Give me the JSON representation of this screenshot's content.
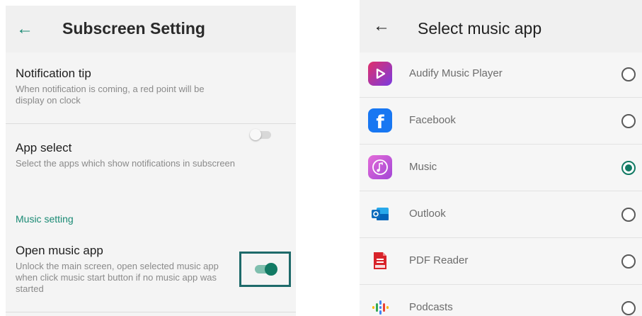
{
  "left_screen": {
    "title": "Subscreen Setting",
    "back_icon": "arrow-left-icon",
    "notification_tip": {
      "title": "Notification tip",
      "description": "When notification is coming, a red point will be display on clock",
      "enabled": false
    },
    "app_select": {
      "title": "App select",
      "description": "Select the apps which show notifications in subscreen"
    },
    "section_label": "Music setting",
    "open_music_app": {
      "title": "Open music app",
      "description": "Unlock the main screen, open selected music app when click music start button if no music app was started",
      "enabled": true
    },
    "accent_color": "#1a8a74"
  },
  "right_screen": {
    "title": "Select music app",
    "back_icon": "arrow-left-icon",
    "apps": [
      {
        "label": "Audify Music Player",
        "icon": "audify-icon",
        "selected": false
      },
      {
        "label": "Facebook",
        "icon": "facebook-icon",
        "selected": false
      },
      {
        "label": "Music",
        "icon": "music-icon",
        "selected": true
      },
      {
        "label": "Outlook",
        "icon": "outlook-icon",
        "selected": false
      },
      {
        "label": "PDF Reader",
        "icon": "pdf-reader-icon",
        "selected": false
      },
      {
        "label": "Podcasts",
        "icon": "podcasts-icon",
        "selected": false
      }
    ],
    "selected_color": "#127a64"
  }
}
